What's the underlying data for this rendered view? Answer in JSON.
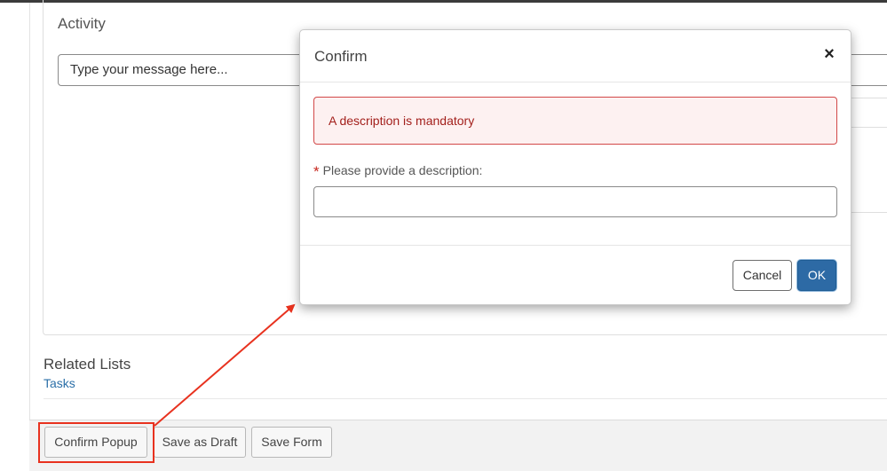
{
  "activity": {
    "title": "Activity",
    "input_placeholder": "Type your message here..."
  },
  "related": {
    "title": "Related Lists",
    "link": "Tasks"
  },
  "footer": {
    "confirm_popup_label": "Confirm Popup",
    "save_draft_label": "Save as Draft",
    "save_form_label": "Save Form"
  },
  "annotation": {
    "highlight_color": "#e8321f"
  },
  "modal": {
    "title": "Confirm",
    "close_symbol": "×",
    "alert_text": "A description is mandatory",
    "required_marker": "*",
    "field_label": "Please provide a description:",
    "field_value": "",
    "cancel_label": "Cancel",
    "ok_label": "OK"
  },
  "colors": {
    "primary": "#2d6aa5",
    "alert_text": "#a3201c",
    "alert_border": "#d24848",
    "link": "#2b6fa8"
  }
}
